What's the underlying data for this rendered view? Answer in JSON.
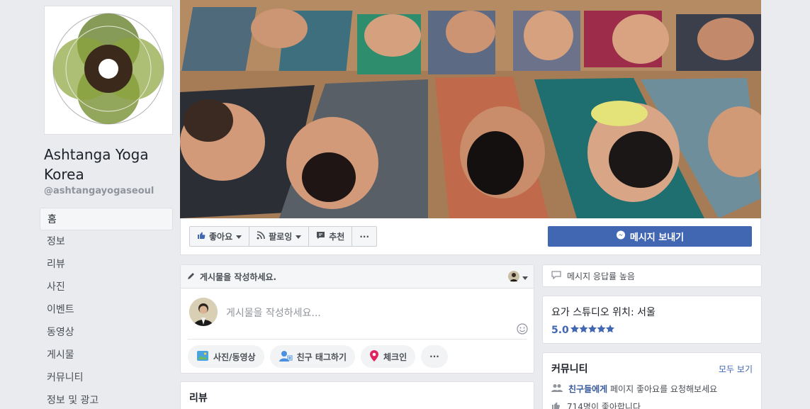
{
  "page": {
    "name": "Ashtanga Yoga Korea",
    "handle": "@ashtangayogaseoul"
  },
  "nav": {
    "items": [
      {
        "label": "홈"
      },
      {
        "label": "정보"
      },
      {
        "label": "리뷰"
      },
      {
        "label": "사진"
      },
      {
        "label": "이벤트"
      },
      {
        "label": "동영상"
      },
      {
        "label": "게시물"
      },
      {
        "label": "커뮤니티"
      },
      {
        "label": "정보 및 광고"
      }
    ]
  },
  "actions": {
    "like": "좋아요",
    "follow": "팔로잉",
    "recommend": "추천",
    "more": "···",
    "message": "메시지 보내기"
  },
  "composer": {
    "header": "게시물을 작성하세요.",
    "placeholder": "게시물을 작성하세요...",
    "photo_video": "사진/동영상",
    "tag_friends": "친구 태그하기",
    "checkin": "체크인",
    "more": "···"
  },
  "reviews": {
    "title": "리뷰"
  },
  "sidebar": {
    "response": "메시지 응답률 높음",
    "location": "요가 스튜디오 위치: 서울",
    "rating": "5.0",
    "community": {
      "title": "커뮤니티",
      "see_all": "모두 보기",
      "invite_bold": "친구들에게",
      "invite_text": " 페이지 좋아요를 요청해보세요",
      "likes_text": "714명이 좋아합니다"
    }
  },
  "colors": {
    "brand": "#4267b2",
    "background": "#e9ebee",
    "link": "#365899"
  }
}
